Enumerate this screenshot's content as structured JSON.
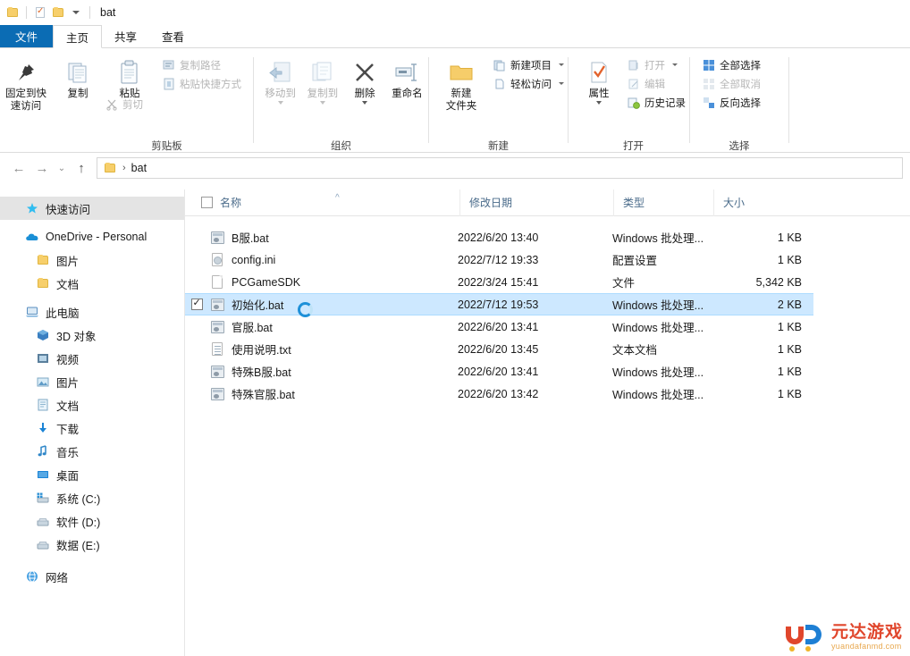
{
  "window": {
    "title": "bat",
    "quick_access": [
      "folder-icon",
      "properties-icon",
      "folder-icon",
      "chevron-down-icon"
    ]
  },
  "tabs": [
    {
      "label": "文件",
      "kind": "file"
    },
    {
      "label": "主页",
      "kind": "active"
    },
    {
      "label": "共享",
      "kind": "normal"
    },
    {
      "label": "查看",
      "kind": "normal"
    }
  ],
  "ribbon": {
    "groups": [
      {
        "name": "clipboard",
        "label": "剪贴板",
        "big": [
          {
            "label": "固定到快\n速访问",
            "line1": "固定到快",
            "line2": "速访问",
            "icon": "pin-icon",
            "dim": false
          },
          {
            "label": "复制",
            "line1": "复制",
            "line2": "",
            "icon": "copy-icon",
            "dim": false
          },
          {
            "label": "粘贴",
            "line1": "粘贴",
            "line2": "",
            "icon": "paste-icon",
            "dim": false
          }
        ],
        "small": [
          {
            "label": "复制路径",
            "icon": "copy-path-icon",
            "dim": true,
            "caret": false
          },
          {
            "label": "粘贴快捷方式",
            "icon": "paste-shortcut-icon",
            "dim": true,
            "caret": false
          }
        ],
        "small_under": [
          {
            "label": "剪切",
            "icon": "scissors-icon",
            "dim": true,
            "caret": false
          }
        ]
      },
      {
        "name": "organize",
        "label": "组织",
        "big": [
          {
            "line1": "移动到",
            "line2": "",
            "icon": "move-to-icon",
            "dim": true,
            "caret": true
          },
          {
            "line1": "复制到",
            "line2": "",
            "icon": "copy-to-icon",
            "dim": true,
            "caret": true
          },
          {
            "line1": "删除",
            "line2": "",
            "icon": "delete-x-icon",
            "dim": false,
            "caret": true
          },
          {
            "line1": "重命名",
            "line2": "",
            "icon": "rename-icon",
            "dim": false,
            "caret": false
          }
        ]
      },
      {
        "name": "new",
        "label": "新建",
        "big": [
          {
            "line1": "新建",
            "line2": "文件夹",
            "icon": "new-folder-icon",
            "dim": false,
            "caret": false
          }
        ],
        "small": [
          {
            "label": "新建项目",
            "icon": "new-item-icon",
            "dim": false,
            "caret": true
          },
          {
            "label": "轻松访问",
            "icon": "easy-access-icon",
            "dim": false,
            "caret": true
          }
        ]
      },
      {
        "name": "open",
        "label": "打开",
        "big": [
          {
            "line1": "属性",
            "line2": "",
            "icon": "properties-icon",
            "dim": false,
            "caret": true
          }
        ],
        "small": [
          {
            "label": "打开",
            "icon": "open-icon",
            "dim": true,
            "caret": true
          },
          {
            "label": "编辑",
            "icon": "edit-icon",
            "dim": true,
            "caret": false
          },
          {
            "label": "历史记录",
            "icon": "history-icon",
            "dim": false,
            "caret": false
          }
        ]
      },
      {
        "name": "select",
        "label": "选择",
        "small": [
          {
            "label": "全部选择",
            "icon": "select-all-icon",
            "dim": false,
            "caret": false
          },
          {
            "label": "全部取消",
            "icon": "select-none-icon",
            "dim": true,
            "caret": false
          },
          {
            "label": "反向选择",
            "icon": "invert-selection-icon",
            "dim": false,
            "caret": false
          }
        ]
      }
    ]
  },
  "addressbar": {
    "back": "←",
    "forward": "→",
    "recent": "⌄",
    "up": "↑",
    "crumb_icon": "folder-icon",
    "separator": "›",
    "path": "bat"
  },
  "sidebar": {
    "items": [
      {
        "label": "快速访问",
        "icon": "star-icon",
        "level": 1,
        "selected": true
      },
      {
        "label": "OneDrive - Personal",
        "icon": "onedrive-cloud-icon",
        "level": 1,
        "selected": false
      },
      {
        "label": "图片",
        "icon": "folder-icon",
        "level": 2,
        "selected": false
      },
      {
        "label": "文档",
        "icon": "folder-icon",
        "level": 2,
        "selected": false
      },
      {
        "label": "此电脑",
        "icon": "this-pc-icon",
        "level": 1,
        "selected": false
      },
      {
        "label": "3D 对象",
        "icon": "3d-objects-icon",
        "level": 2,
        "selected": false
      },
      {
        "label": "视频",
        "icon": "videos-icon",
        "level": 2,
        "selected": false
      },
      {
        "label": "图片",
        "icon": "pictures-icon",
        "level": 2,
        "selected": false
      },
      {
        "label": "文档",
        "icon": "documents-icon",
        "level": 2,
        "selected": false
      },
      {
        "label": "下载",
        "icon": "downloads-icon",
        "level": 2,
        "selected": false
      },
      {
        "label": "音乐",
        "icon": "music-icon",
        "level": 2,
        "selected": false
      },
      {
        "label": "桌面",
        "icon": "desktop-icon",
        "level": 2,
        "selected": false
      },
      {
        "label": "系统 (C:)",
        "icon": "system-drive-icon",
        "level": 2,
        "selected": false
      },
      {
        "label": "软件 (D:)",
        "icon": "drive-icon",
        "level": 2,
        "selected": false
      },
      {
        "label": "数据 (E:)",
        "icon": "drive-icon",
        "level": 2,
        "selected": false
      },
      {
        "label": "网络",
        "icon": "network-icon",
        "level": 1,
        "selected": false
      }
    ]
  },
  "filelist": {
    "columns": [
      {
        "label": "名称",
        "key": "name"
      },
      {
        "label": "修改日期",
        "key": "date"
      },
      {
        "label": "类型",
        "key": "type"
      },
      {
        "label": "大小",
        "key": "size"
      }
    ],
    "sort_indicator": "^",
    "rows": [
      {
        "name": "B服.bat",
        "date": "2022/6/20 13:40",
        "type": "Windows 批处理...",
        "size": "1 KB",
        "icon": "bat-file-icon",
        "selected": false,
        "checked": false
      },
      {
        "name": "config.ini",
        "date": "2022/7/12 19:33",
        "type": "配置设置",
        "size": "1 KB",
        "icon": "ini-file-icon",
        "selected": false,
        "checked": false
      },
      {
        "name": "PCGameSDK",
        "date": "2022/3/24 15:41",
        "type": "文件",
        "size": "5,342 KB",
        "icon": "generic-file-icon",
        "selected": false,
        "checked": false
      },
      {
        "name": "初始化.bat",
        "date": "2022/7/12 19:53",
        "type": "Windows 批处理...",
        "size": "2 KB",
        "icon": "bat-file-icon",
        "selected": true,
        "checked": true
      },
      {
        "name": "官服.bat",
        "date": "2022/6/20 13:41",
        "type": "Windows 批处理...",
        "size": "1 KB",
        "icon": "bat-file-icon",
        "selected": false,
        "checked": false
      },
      {
        "name": "使用说明.txt",
        "date": "2022/6/20 13:45",
        "type": "文本文档",
        "size": "1 KB",
        "icon": "text-file-icon",
        "selected": false,
        "checked": false
      },
      {
        "name": "特殊B服.bat",
        "date": "2022/6/20 13:41",
        "type": "Windows 批处理...",
        "size": "1 KB",
        "icon": "bat-file-icon",
        "selected": false,
        "checked": false
      },
      {
        "name": "特殊官服.bat",
        "date": "2022/6/20 13:42",
        "type": "Windows 批处理...",
        "size": "1 KB",
        "icon": "bat-file-icon",
        "selected": false,
        "checked": false
      }
    ]
  },
  "cursor": {
    "type": "busy-ring-cursor"
  },
  "watermark": {
    "cn": "元达游戏",
    "en": "yuandafanmd.com"
  },
  "colors": {
    "file_tab_blue": "#0b6cb4",
    "selection_blue": "#cde8ff",
    "header_text": "#4a6b8a",
    "folder_yellow": "#f7cf6b",
    "busy_ring": "#1e90d8",
    "watermark_red": "#e0462c",
    "watermark_blue": "#1e7fd4"
  }
}
